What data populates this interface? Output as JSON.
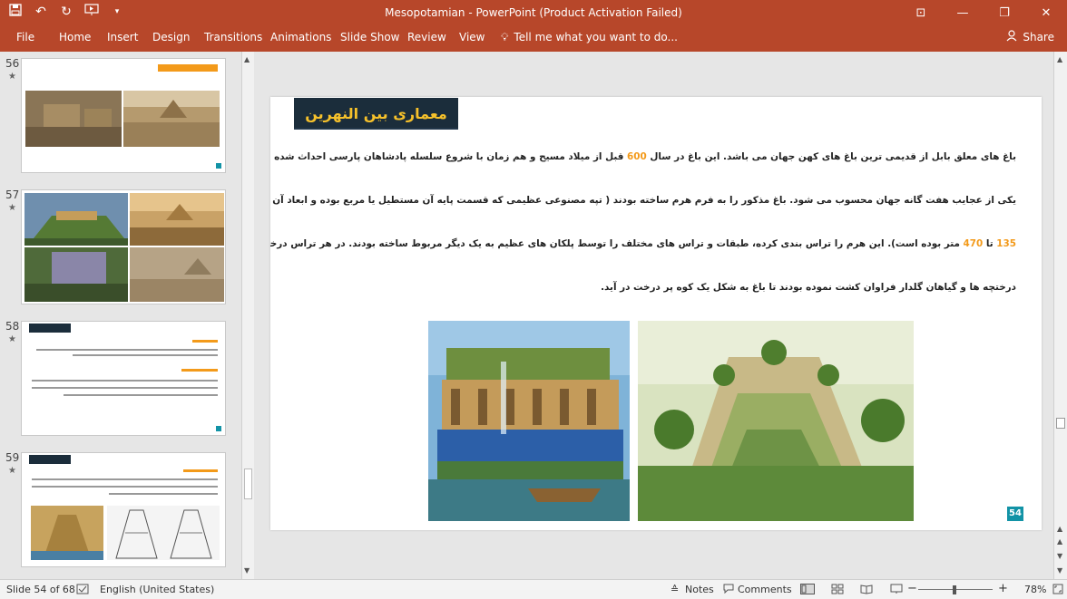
{
  "window": {
    "title": "Mesopotamian - PowerPoint (Product Activation Failed)",
    "qat_icons": [
      "save-icon",
      "undo-icon",
      "redo-icon",
      "present-icon",
      "customize-icon"
    ],
    "controls": [
      "ribbon-display-icon",
      "minimize-icon",
      "maximize-icon",
      "close-icon"
    ]
  },
  "ribbon": {
    "file": "File",
    "tabs": [
      "Home",
      "Insert",
      "Design",
      "Transitions",
      "Animations",
      "Slide Show",
      "Review",
      "View"
    ],
    "tell_me": "Tell me what you want to do...",
    "share": "Share"
  },
  "thumbnails": [
    {
      "num": "56",
      "star": "★"
    },
    {
      "num": "57",
      "star": "★"
    },
    {
      "num": "58",
      "star": "★"
    },
    {
      "num": "59",
      "star": "★"
    }
  ],
  "slide": {
    "title": "معماری بین النهرین",
    "line1_pre": "باغ های معلق بابل از قدیمی ترین باغ های کهن جهان می باشد. این باغ در سال ",
    "line1_num": "600",
    "line1_post": " قبل از میلاد مسیح و هم زمان با شروع سلسله پادشاهان پارسی احداث شده است. این باغ",
    "line2": "یکی از عجایب هفت گانه جهان محسوب می شود. باغ مذکور را به فرم هرم ساخته بودند ( تپه مصنوعی عظیمی که قسمت پایه آن مستطیل یا مربع بوده و ابعاد آن احتمالاً از",
    "line3_num1": "135",
    "line3_mid": " تا ",
    "line3_num2": "470",
    "line3_post": " متر بوده است). این هرم را تراس بندی کرده، طبقات و تراس های مختلف را توسط پلکان های عظیم به یک دیگر مربوط ساخته بودند. در هر تراس درختان و",
    "line4": "درختچه ها و گیاهان گلدار فراوان کشت نموده بودند تا باغ به شکل یک کوه پر درخت در آید.",
    "number": "54"
  },
  "status": {
    "slide_info": "Slide 54 of 68",
    "language": "English (United States)",
    "notes": "Notes",
    "comments": "Comments",
    "zoom": "78%"
  },
  "colors": {
    "accent": "#b7472a",
    "title_bg": "#1b2d3b",
    "title_text": "#f6c12b",
    "number_orange": "#f39a1a",
    "badge": "#1293a6"
  }
}
